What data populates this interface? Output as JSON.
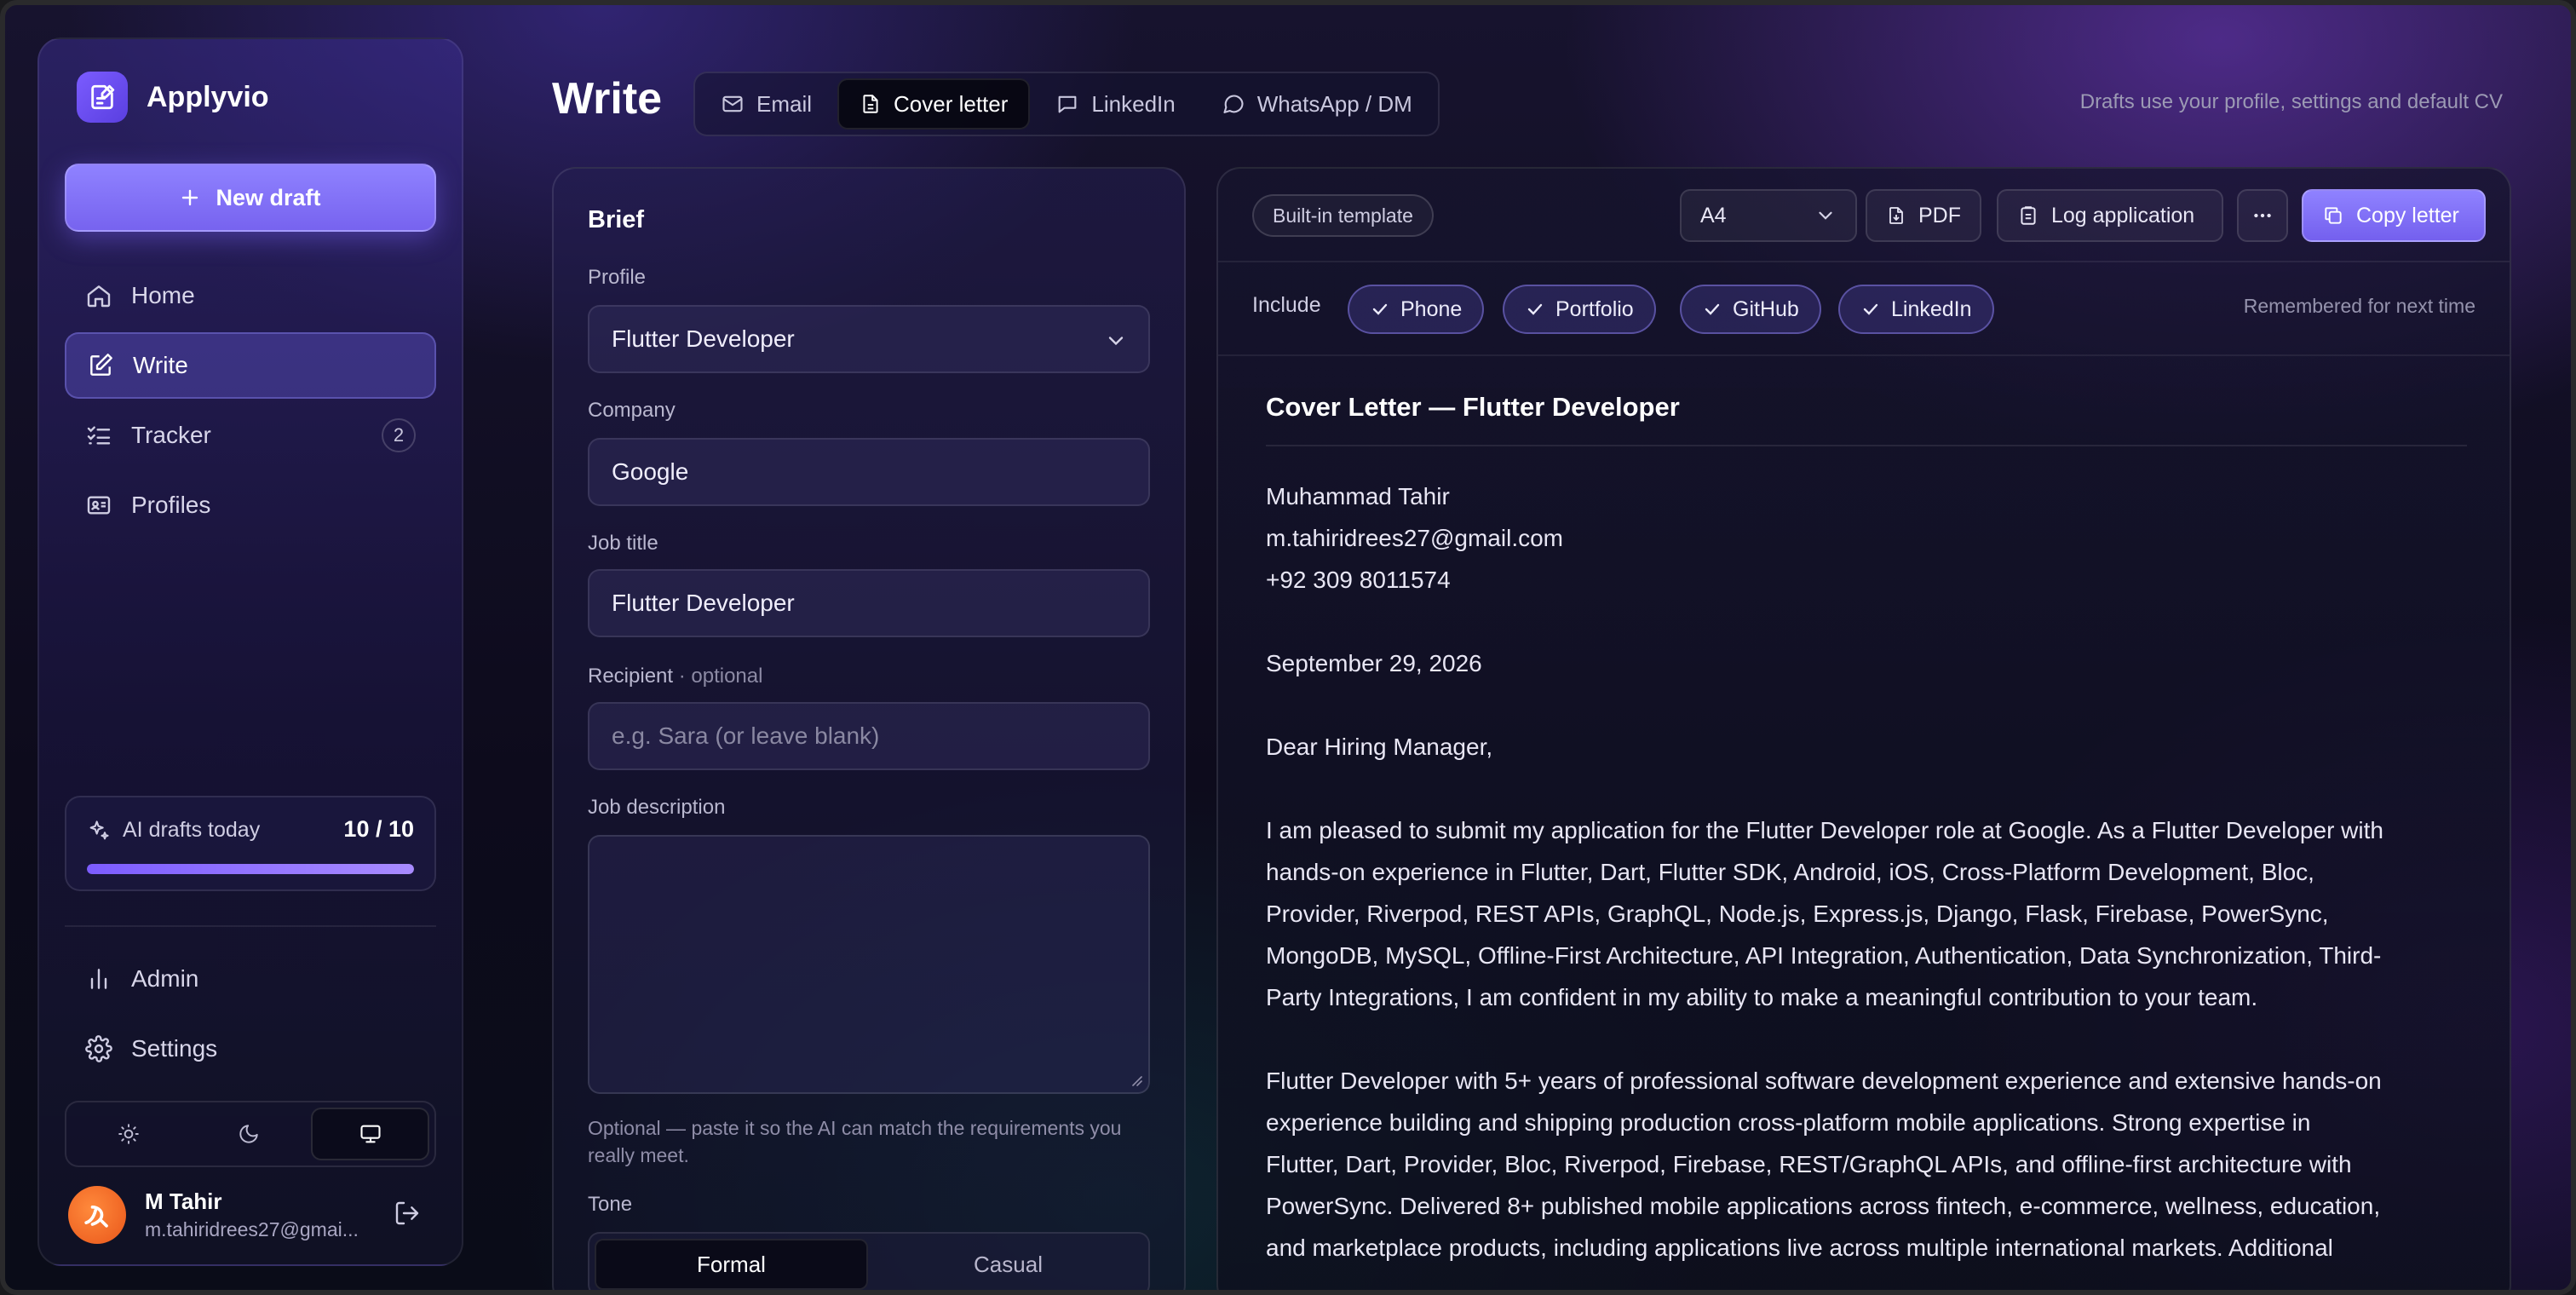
{
  "app": {
    "name": "Applyvio",
    "new_draft_label": "New draft",
    "accent": "#7c66f2"
  },
  "sidebar": {
    "items": [
      {
        "label": "Home",
        "icon": "home-icon"
      },
      {
        "label": "Write",
        "icon": "edit-icon",
        "active": true
      },
      {
        "label": "Tracker",
        "icon": "checklist-icon",
        "count": "2"
      },
      {
        "label": "Profiles",
        "icon": "id-card-icon"
      }
    ],
    "ai_drafts": {
      "label": "AI drafts today",
      "count": "10 / 10",
      "progress": 1.0
    },
    "secondary": [
      {
        "label": "Admin",
        "icon": "bar-chart-icon"
      },
      {
        "label": "Settings",
        "icon": "gear-icon"
      }
    ],
    "theme_options": [
      "sun-icon",
      "moon-icon",
      "monitor-icon"
    ],
    "theme_selected": "monitor-icon",
    "user": {
      "name": "M Tahir",
      "email": "m.tahiridrees27@gmai..."
    }
  },
  "header": {
    "title": "Write",
    "tabs": [
      {
        "label": "Email",
        "icon": "mail-icon"
      },
      {
        "label": "Cover letter",
        "icon": "document-icon",
        "active": true
      },
      {
        "label": "LinkedIn",
        "icon": "message-square-icon"
      },
      {
        "label": "WhatsApp / DM",
        "icon": "message-circle-icon"
      }
    ],
    "note": "Drafts use your profile, settings and default CV"
  },
  "brief": {
    "title": "Brief",
    "profile_label": "Profile",
    "profile_value": "Flutter Developer",
    "company_label": "Company",
    "company_value": "Google",
    "job_title_label": "Job title",
    "job_title_value": "Flutter Developer",
    "recipient_label": "Recipient",
    "recipient_optional": " · optional",
    "recipient_placeholder": "e.g. Sara (or leave blank)",
    "job_description_label": "Job description",
    "job_description_help": "Optional — paste it so the AI can match the requirements you really meet.",
    "tone_label": "Tone",
    "tone_options": [
      "Formal",
      "Casual"
    ],
    "tone_selected": "Formal"
  },
  "letter": {
    "template_badge": "Built-in template",
    "page_size": "A4",
    "pdf_label": "PDF",
    "log_label": "Log application",
    "copy_label": "Copy letter",
    "include_label": "Include",
    "include_chips": [
      "Phone",
      "Portfolio",
      "GitHub",
      "LinkedIn"
    ],
    "remember_note": "Remembered for next time",
    "title": "Cover Letter — Flutter Developer",
    "sender_name": "Muhammad Tahir",
    "sender_email": "m.tahiridrees27@gmail.com",
    "sender_phone": "+92 309 8011574",
    "date": "September 29, 2026",
    "salutation": "Dear Hiring Manager,",
    "para1": [
      "I am pleased to submit my application for the Flutter Developer role at Google. As a Flutter Developer with",
      "hands-on experience in Flutter, Dart, Flutter SDK, Android, iOS, Cross-Platform Development, Bloc,",
      "Provider, Riverpod, REST APIs, GraphQL, Node.js, Express.js, Django, Flask, Firebase, PowerSync,",
      "MongoDB, MySQL, Offline-First Architecture, API Integration, Authentication, Data Synchronization, Third-",
      "Party Integrations, I am confident in my ability to make a meaningful contribution to your team."
    ],
    "para2": [
      "Flutter Developer with 5+ years of professional software development experience and extensive hands-on",
      "experience building and shipping production cross-platform mobile applications. Strong expertise in",
      "Flutter, Dart, Provider, Bloc, Riverpod, Firebase, REST/GraphQL APIs, and offline-first architecture with",
      "PowerSync. Delivered 8+ published mobile applications across fintech, e-commerce, wellness, education,",
      "and marketplace products, including applications live across multiple international markets. Additional"
    ]
  }
}
